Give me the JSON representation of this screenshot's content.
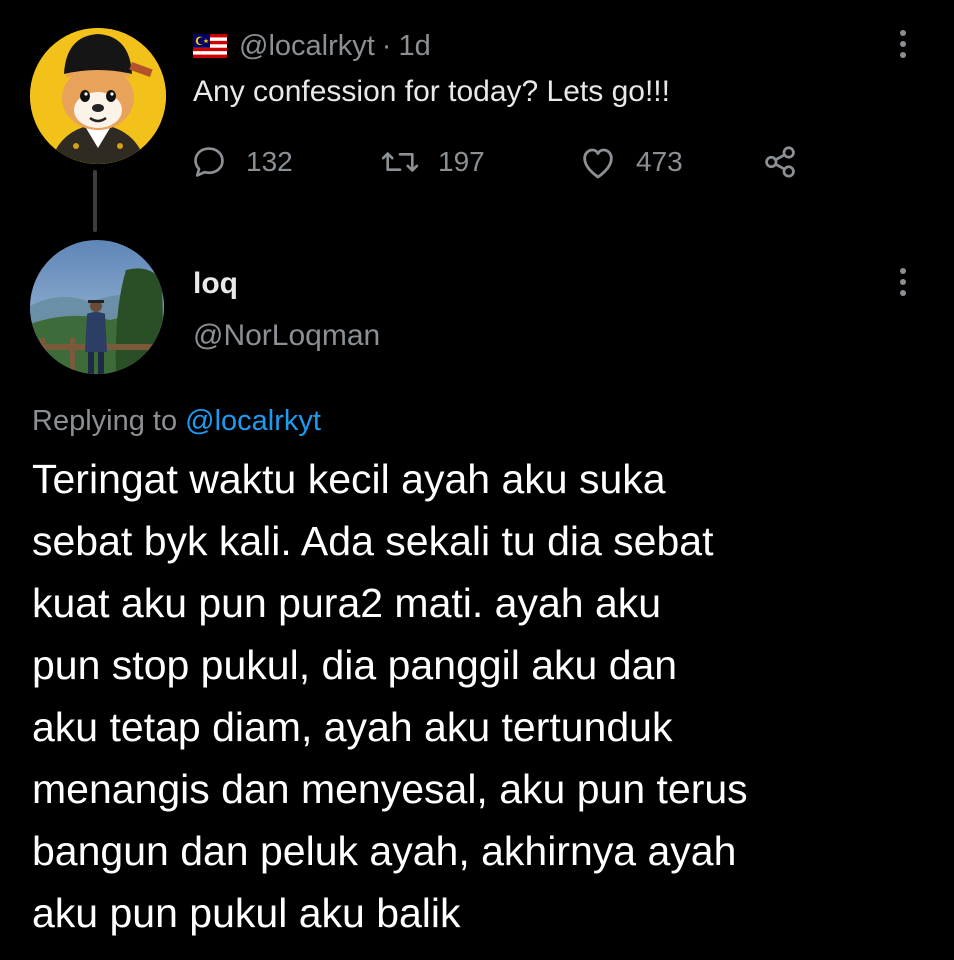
{
  "parent_tweet": {
    "flag_icon": "malaysia-flag-icon",
    "handle": "@localrkyt",
    "separator": "·",
    "time": "1d",
    "text": "Any confession for today? Lets go!!!",
    "actions": {
      "reply_count": "132",
      "retweet_count": "197",
      "like_count": "473"
    },
    "menu_icon": "more-vertical-icon"
  },
  "reply_tweet": {
    "name": "loq",
    "handle": "@NorLoqman",
    "replying_prefix": "Replying to",
    "replying_to": "@localrkyt",
    "lines": [
      "Teringat waktu kecil ayah aku suka",
      "sebat byk kali. Ada sekali tu dia sebat",
      "kuat aku pun pura2 mati. ayah aku",
      "pun stop pukul, dia panggil aku dan",
      "aku tetap diam, ayah aku tertunduk",
      "menangis dan menyesal, aku pun terus",
      "bangun dan peluk ayah, akhirnya ayah",
      "aku pun pukul aku balik"
    ],
    "menu_icon": "more-vertical-icon"
  },
  "colors": {
    "background": "#000000",
    "primary_text": "#e7e9ea",
    "secondary_text": "#8b9095",
    "link": "#1d9bf0",
    "thread_line": "#3a3d41"
  }
}
